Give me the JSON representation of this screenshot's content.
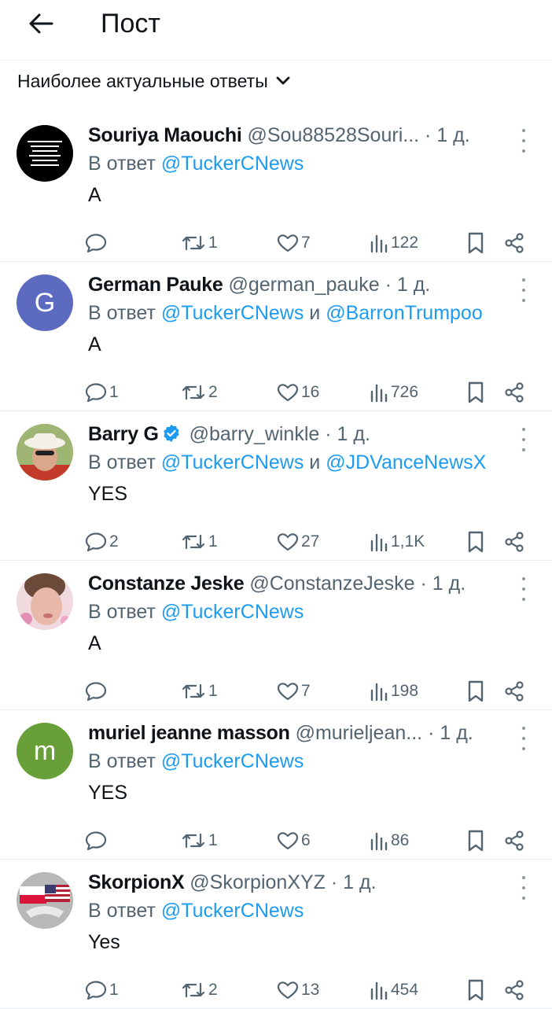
{
  "header": {
    "title": "Пост"
  },
  "sort": {
    "label": "Наиболее актуальные ответы"
  },
  "reply_prefix": "В ответ",
  "reply_joiner": "и",
  "colors": {
    "accent": "#1d9bf0",
    "muted": "#536471",
    "text": "#0f1419"
  },
  "posts": [
    {
      "name": "Souriya Maouchi",
      "handle": "@Sou88528Souri...",
      "dot": "·",
      "time": "1 д.",
      "verified": false,
      "reply_to": [
        "@TuckerCNews"
      ],
      "text": "A",
      "replies": "",
      "reposts": "1",
      "likes": "7",
      "views": "122",
      "avatar": {
        "type": "image-black",
        "caption": "La tangente est une arme redoutable On ne peut ni maltraiter ni gober quelqu'un qui n'oublie pas !"
      }
    },
    {
      "name": "German Pauke",
      "handle": "@german_pauke",
      "dot": "·",
      "time": "1 д.",
      "verified": false,
      "reply_to": [
        "@TuckerCNews",
        "@BarronTrumpoo"
      ],
      "text": "A",
      "replies": "1",
      "reposts": "2",
      "likes": "16",
      "views": "726",
      "avatar": {
        "type": "letter",
        "letter": "G",
        "color": "#5c6bc0"
      }
    },
    {
      "name": "Barry G",
      "handle": "@barry_winkle",
      "dot": "·",
      "time": "1 д.",
      "verified": true,
      "reply_to": [
        "@TuckerCNews",
        "@JDVanceNewsX"
      ],
      "text": "YES",
      "replies": "2",
      "reposts": "1",
      "likes": "27",
      "views": "1,1K",
      "avatar": {
        "type": "photo-hat"
      }
    },
    {
      "name": "Constanze Jeske",
      "handle": "@ConstanzeJeske",
      "dot": "·",
      "time": "1 д.",
      "verified": false,
      "reply_to": [
        "@TuckerCNews"
      ],
      "text": "A",
      "replies": "",
      "reposts": "1",
      "likes": "7",
      "views": "198",
      "avatar": {
        "type": "photo-face"
      }
    },
    {
      "name": "muriel jeanne masson",
      "handle": "@murieljean...",
      "dot": "·",
      "time": "1 д.",
      "verified": false,
      "reply_to": [
        "@TuckerCNews"
      ],
      "text": "YES",
      "replies": "",
      "reposts": "1",
      "likes": "6",
      "views": "86",
      "avatar": {
        "type": "letter",
        "letter": "m",
        "color": "#689f38"
      }
    },
    {
      "name": "SkorpionX",
      "handle": "@SkorpionXYZ",
      "dot": "·",
      "time": "1 д.",
      "verified": false,
      "reply_to": [
        "@TuckerCNews"
      ],
      "text": "Yes",
      "replies": "1",
      "reposts": "2",
      "likes": "13",
      "views": "454",
      "avatar": {
        "type": "flags"
      }
    }
  ]
}
